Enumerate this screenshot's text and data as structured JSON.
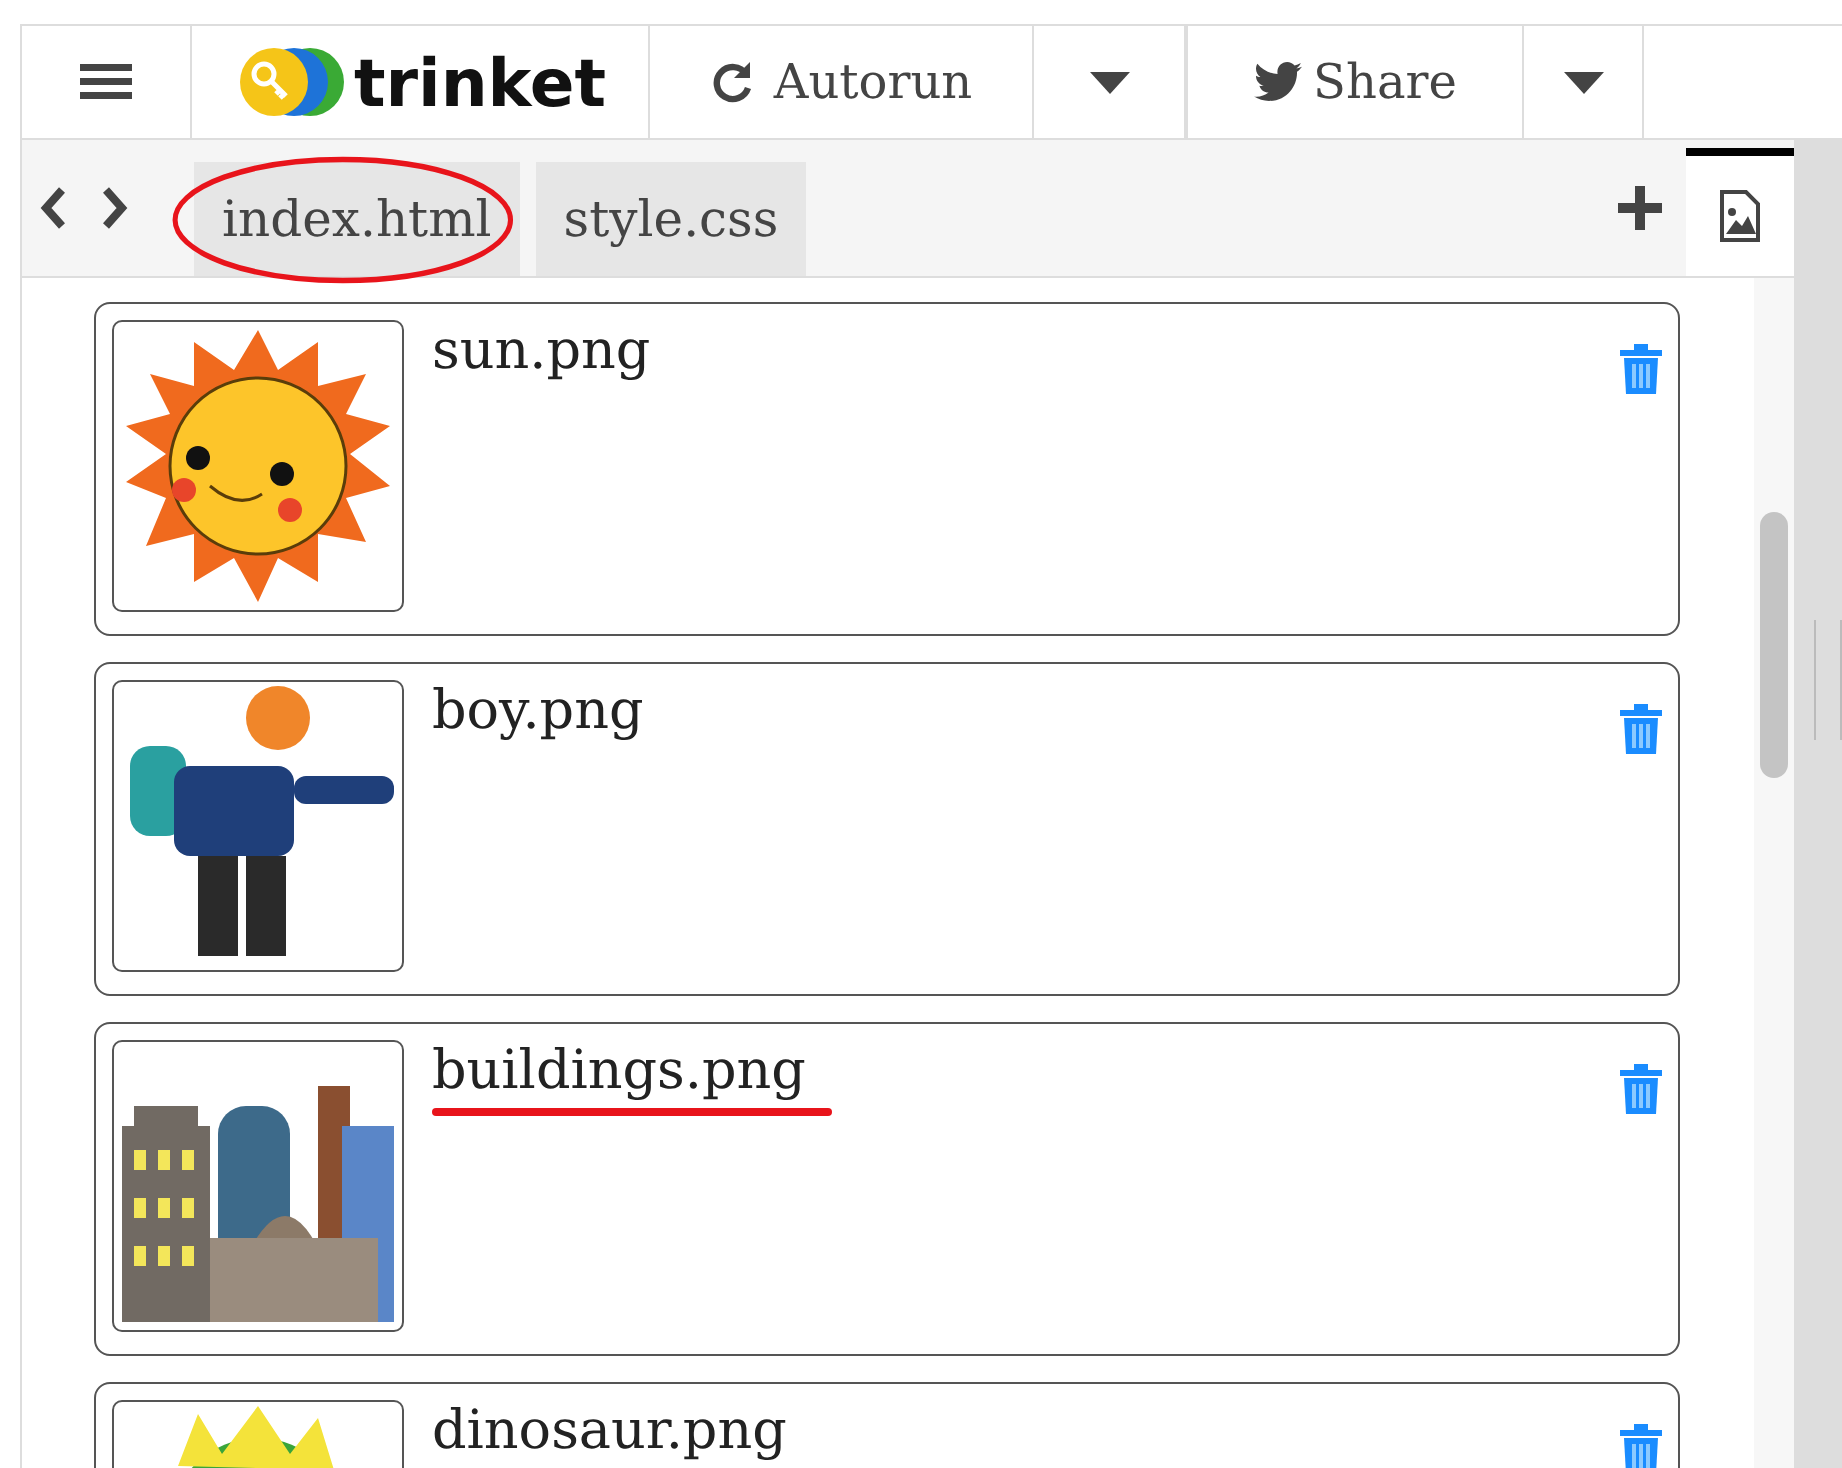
{
  "toolbar": {
    "logo": "trinket",
    "autorun": "Autorun",
    "share": "Share"
  },
  "tabs": [
    {
      "label": "index.html",
      "selected": false,
      "circled": true
    },
    {
      "label": "style.css",
      "selected": false,
      "circled": false
    }
  ],
  "images_tab": {
    "selected": true
  },
  "images": [
    {
      "name": "sun.png",
      "underlined": false
    },
    {
      "name": "boy.png",
      "underlined": false
    },
    {
      "name": "buildings.png",
      "underlined": true
    },
    {
      "name": "dinosaur.png",
      "underlined": false
    }
  ]
}
